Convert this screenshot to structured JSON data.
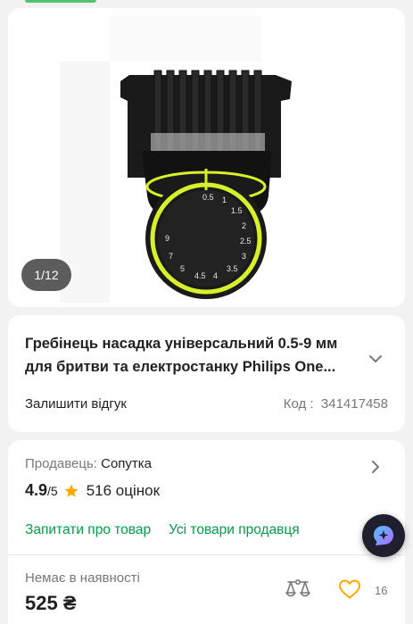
{
  "gallery": {
    "counter": "1/12",
    "dial_labels": [
      "0.5",
      "1",
      "1.5",
      "2",
      "2.5",
      "3",
      "3.5",
      "4",
      "4.5",
      "5",
      "7",
      "9"
    ]
  },
  "product": {
    "title": "Гребінець насадка універсальний 0.5-9 мм для бритви та електростанку Philips One...",
    "review_link": "Залишити відгук",
    "code_label": "Код :",
    "code_value": "341417458"
  },
  "seller": {
    "label": "Продавець:",
    "name": "Сопутка",
    "rating": "4.9",
    "rating_max": "/5",
    "reviews": "516 оцінок",
    "ask_link": "Запитати про товар",
    "all_goods_link": "Усі товари продавця"
  },
  "purchase": {
    "stock_status": "Немає в наявності",
    "price": "525 ₴",
    "favorites_count": "16"
  },
  "colors": {
    "accent_green": "#00a046",
    "star": "#ffa900",
    "heart": "#ffa900",
    "dial_ring": "#d8f02a"
  }
}
